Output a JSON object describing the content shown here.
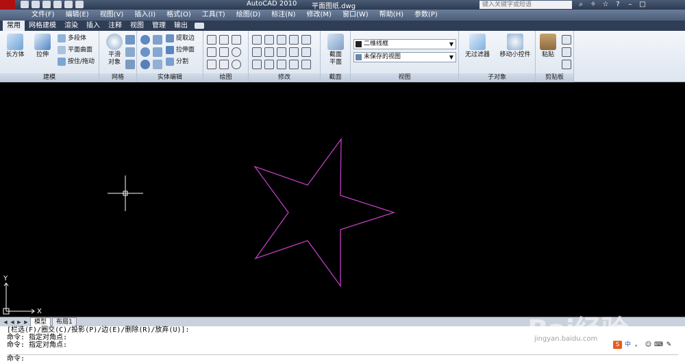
{
  "titlebar": {
    "app_title": "AutoCAD 2010",
    "file_title": "平面图纸.dwg",
    "search_placeholder": "键入关键字或短语"
  },
  "menu": [
    "文件(F)",
    "编辑(E)",
    "视图(V)",
    "插入(I)",
    "格式(O)",
    "工具(T)",
    "绘图(D)",
    "标注(N)",
    "修改(M)",
    "窗口(W)",
    "帮助(H)",
    "参数(P)"
  ],
  "ribbon_tabs": [
    "常用",
    "网格建模",
    "渲染",
    "插入",
    "注释",
    "视图",
    "管理",
    "输出"
  ],
  "panels": {
    "modeling": {
      "title": "建模",
      "box": "长方体",
      "extrude": "拉伸",
      "polysolid": "多段体",
      "planar_surface": "平面曲面",
      "presspull": "按住/拖动"
    },
    "mesh": {
      "title": "网格",
      "smooth": "平滑\n对象",
      "smooth_l1": "平滑",
      "smooth_l2": "对象"
    },
    "solid_edit": {
      "title": "实体编辑",
      "extract_edges": "提取边",
      "extrude_faces": "拉伸面",
      "separate": "分割"
    },
    "draw": {
      "title": "绘图"
    },
    "modify": {
      "title": "修改"
    },
    "section": {
      "title": "截面",
      "section_plane_l1": "截面",
      "section_plane_l2": "平面"
    },
    "view": {
      "title": "视图",
      "visual_style": "二维线框",
      "saved_view": "未保存的视图"
    },
    "subobject": {
      "title": "子对象",
      "no_filter": "无过滤器",
      "move_gizmo": "移动小控件"
    },
    "clipboard": {
      "title": "剪贴板",
      "paste": "粘贴"
    }
  },
  "drawing": {
    "background": "#000000",
    "star_color": "#c23fc4",
    "crosshair_color": "#ffffff",
    "ucs_x": "X",
    "ucs_y": "Y"
  },
  "layout_tabs": [
    "模型",
    "布局1"
  ],
  "command_lines": [
    "[栏选(F)/圈交(C)/投影(P)/边(E)/删除(R)/放弃(U)]:",
    "命令: 指定对角点:",
    "命令: 指定对角点:"
  ],
  "command_prompt": "命令:",
  "watermark": {
    "brand": "Bai经验",
    "url": "jingyan.baidu.com"
  },
  "ime": [
    "S",
    "中",
    "。",
    "☺",
    "⌨",
    "✎"
  ]
}
